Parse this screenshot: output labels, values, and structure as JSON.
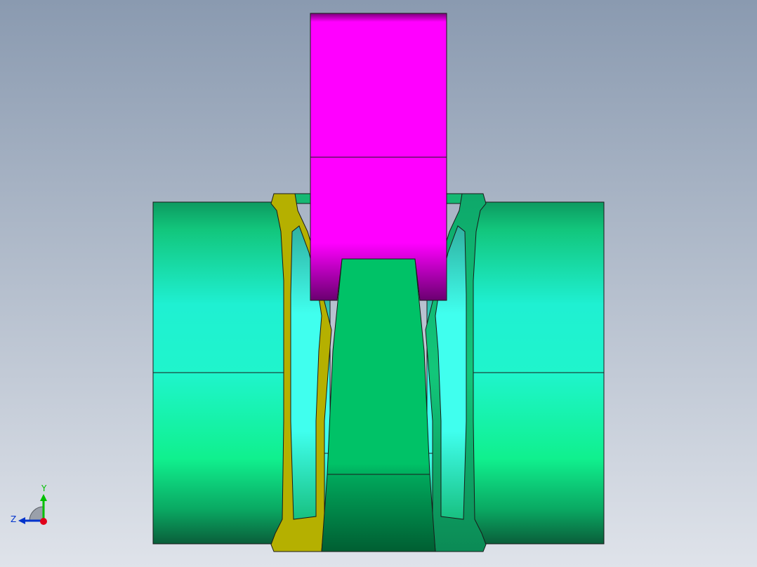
{
  "viewport": {
    "background_top": "#8a9ab0",
    "background_bottom": "#dfe3ea"
  },
  "colors": {
    "outline": "#1a1a1a",
    "hub_green": "#1bd88f",
    "hub_cyan": "#1ff0d2",
    "hub_dark": "#0a6b44",
    "yellow_part": "#b5b000",
    "mid_green": "#00c267",
    "magenta_part": "#ff00ff",
    "window_cyan": "#40ffee"
  },
  "triad": {
    "y_label": "Y",
    "z_label": "Z",
    "y_color": "#00c000",
    "z_color": "#0033cc",
    "x_color": "#e0001a"
  }
}
